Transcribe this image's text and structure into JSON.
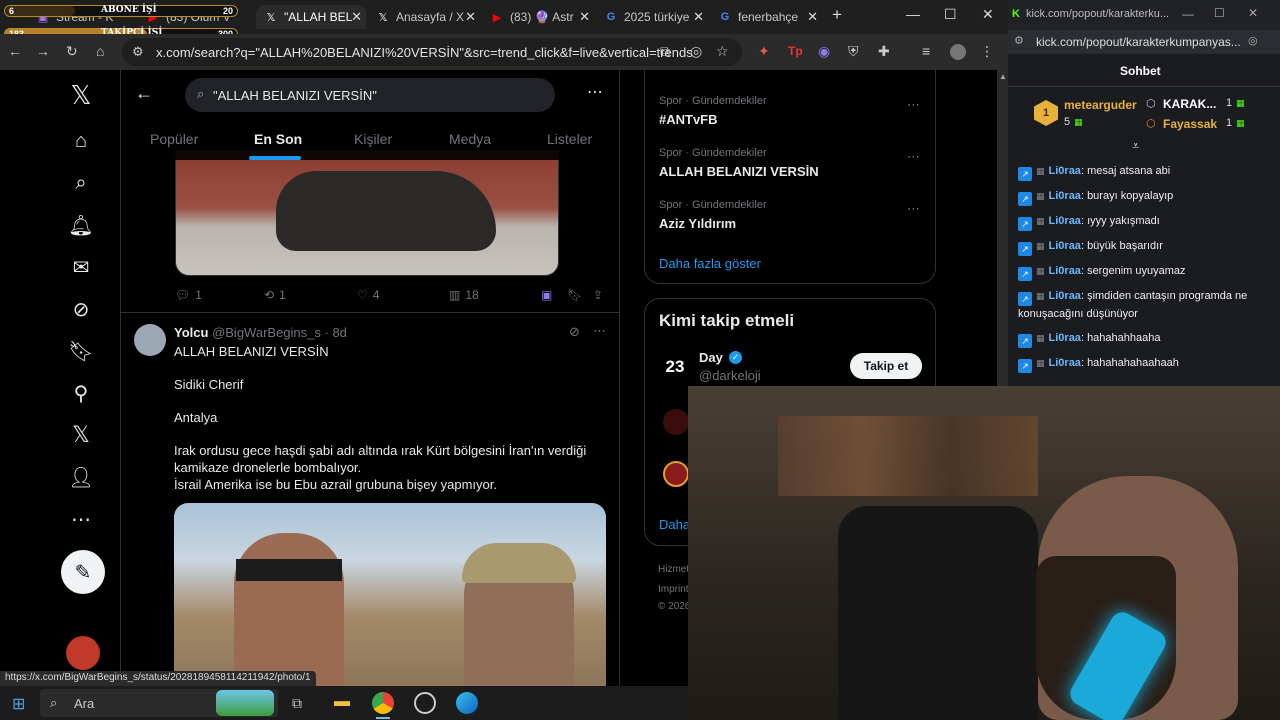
{
  "browser": {
    "tabs": [
      {
        "label": "Stream - K",
        "icon": "twitch-icon"
      },
      {
        "label": "(83) Ölüm V",
        "icon": "youtube-icon"
      },
      {
        "label": "\"ALLAH BEL",
        "icon": "x-icon"
      },
      {
        "label": "Anasayfa / X",
        "icon": "x-icon"
      },
      {
        "label": "(83) 🔮 Astr",
        "icon": "youtube-icon"
      },
      {
        "label": "2025 türkiye",
        "icon": "google-icon"
      },
      {
        "label": "fenerbahçe",
        "icon": "google-icon"
      }
    ],
    "url": "x.com/search?q=\"ALLAH%20BELANIZI%20VERSİN\"&src=trend_click&f=live&vertical=trends",
    "status_url": "https://x.com/BigWarBegins_s/status/2028189458114211942/photo/1"
  },
  "overlay": {
    "abone_label": "ABONE İŞİ",
    "abone_current": "6",
    "abone_goal": "20",
    "takipci_label": "TAKİPÇİ İŞİ",
    "takipci_current": "183",
    "takipci_goal": "300"
  },
  "search": {
    "query": "\"ALLAH BELANIZI VERSİN\"",
    "tabs": [
      "Popüler",
      "En Son",
      "Kişiler",
      "Medya",
      "Listeler"
    ],
    "active_tab": "En Son"
  },
  "tweet1_actions": {
    "replies": "1",
    "retweets": "1",
    "likes": "4",
    "views": "18"
  },
  "tweet2": {
    "name": "Yolcu",
    "handle": "@BigWarBegins_s",
    "time": "· 8d",
    "lines": [
      "ALLAH BELANIZI VERSİN",
      "Sidiki Cherif",
      "Antalya",
      "Irak ordusu gece haşdi şabi adı altında ırak Kürt bölgesini İran'ın verdiği",
      "kamikaze dronelerle bombalıyor.",
      "İsrail Amerika ise bu Ebu azrail grubuna bişey yapmıyor."
    ]
  },
  "trends": [
    {
      "meta": "Spor · Gündemdekiler",
      "title": "#ANTvFB"
    },
    {
      "meta": "Spor · Gündemdekiler",
      "title": "ALLAH BELANIZI VERSİN"
    },
    {
      "meta": "Spor · Gündemdekiler",
      "title": "Aziz Yıldırım"
    }
  ],
  "show_more": "Daha fazla göster",
  "who_to_follow": {
    "title": "Kimi takip etmeli",
    "name": "Day",
    "handle": "@darkeloji",
    "follow_label": "Takip et",
    "more_partial": "Daha",
    "footer1": "Hizmet",
    "footer2": "Imprint",
    "footer3": "© 2026"
  },
  "kick": {
    "url": "kick.com/popout/karakterku...",
    "url_full": "kick.com/popout/karakterkumpanyas...",
    "title": "Sohbet",
    "top_user": "metearguder",
    "top_count": "5",
    "leader1": "KARAK...",
    "leader1_count": "1",
    "leader2": "Fayassak",
    "leader2_count": "1",
    "messages": [
      {
        "user": "Li0raa",
        "text": "mesaj atsana abi"
      },
      {
        "user": "Li0raa",
        "text": "burayı kopyalayıp"
      },
      {
        "user": "Li0raa",
        "text": "ıyyy yakışmadı"
      },
      {
        "user": "Li0raa",
        "text": "büyük başarıdır"
      },
      {
        "user": "Li0raa",
        "text": "sergenim uyuyamaz"
      },
      {
        "user": "Li0raa",
        "text": "şimdiden cantaşın programda ne konuşacağını düşünüyor"
      },
      {
        "user": "Li0raa",
        "text": "hahahahhaaha"
      },
      {
        "user": "Li0raa",
        "text": "hahahahahaahaah"
      }
    ]
  },
  "taskbar": {
    "search_label": "Ara"
  },
  "colors": {
    "accent": "#1d9bf0",
    "kick_green": "#53fc18",
    "badge_blue": "#1e88e5",
    "x_bg": "#000000"
  }
}
